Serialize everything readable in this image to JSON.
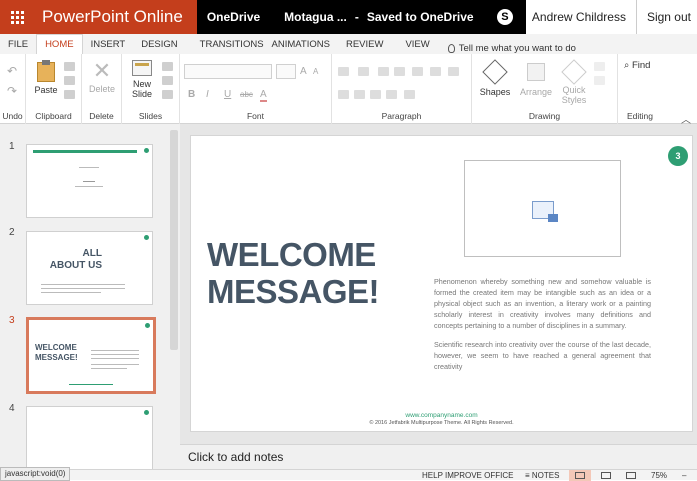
{
  "app": {
    "name": "PowerPoint Online",
    "location": "OneDrive",
    "file_name": "Motagua ...",
    "separator": "-",
    "save_status": "Saved to OneDrive",
    "skype_glyph": "S",
    "user_name": "Andrew Childress",
    "sign_out": "Sign out"
  },
  "ribbon_tabs": [
    "FILE",
    "HOME",
    "INSERT",
    "DESIGN",
    "TRANSITIONS",
    "ANIMATIONS",
    "REVIEW",
    "VIEW"
  ],
  "tell_me": "Tell me what you want to do",
  "ribbon": {
    "undo_label": "Undo",
    "clipboard_label": "Clipboard",
    "paste": "Paste",
    "delete_group": "Delete",
    "delete": "Delete",
    "slides_label": "Slides",
    "new_slide_line1": "New",
    "new_slide_line2": "Slide",
    "font_label": "Font",
    "paragraph_label": "Paragraph",
    "drawing_label": "Drawing",
    "shapes": "Shapes",
    "arrange": "Arrange",
    "quick_styles_line1": "Quick",
    "quick_styles_line2": "Styles",
    "editing_label": "Editing",
    "find": "Find",
    "format_glyphs": [
      "B",
      "I",
      "U",
      "abc",
      "A"
    ],
    "size_glyphs": [
      "A",
      "A"
    ]
  },
  "thumbnails": [
    {
      "num": "1",
      "title": "",
      "subtitle": ""
    },
    {
      "num": "2",
      "title_line1": "ALL",
      "title_line2": "ABOUT US"
    },
    {
      "num": "3",
      "title_line1": "WELCOME",
      "title_line2": "MESSAGE!"
    },
    {
      "num": "4"
    }
  ],
  "slide": {
    "badge": "3",
    "title_line1": "WELCOME",
    "title_line2": "MESSAGE!",
    "body_p1": "Phenomenon whereby something new and somehow valuable is formed the created item may be intangible such as an idea or a physical object such as an invention, a literary work or a painting scholarly interest in creativity involves many definitions and concepts pertaining to a number of disciplines in a summary.",
    "body_p2": "Scientific research into creativity over the course of the last decade, however, we seem to have reached a general agreement that creativity",
    "footer_url": "www.companyname.com",
    "footer_copy": "© 2016 Jetfabrik Multipurpose Theme. All Rights Reserved."
  },
  "notes_placeholder": "Click to add notes",
  "status": {
    "url": "javascript:void(0)",
    "help": "HELP IMPROVE OFFICE",
    "notes": "NOTES",
    "zoom": "75%"
  },
  "colors": {
    "accent": "#c43e1c",
    "slide_green": "#2e9e73",
    "title_slate": "#455565"
  }
}
